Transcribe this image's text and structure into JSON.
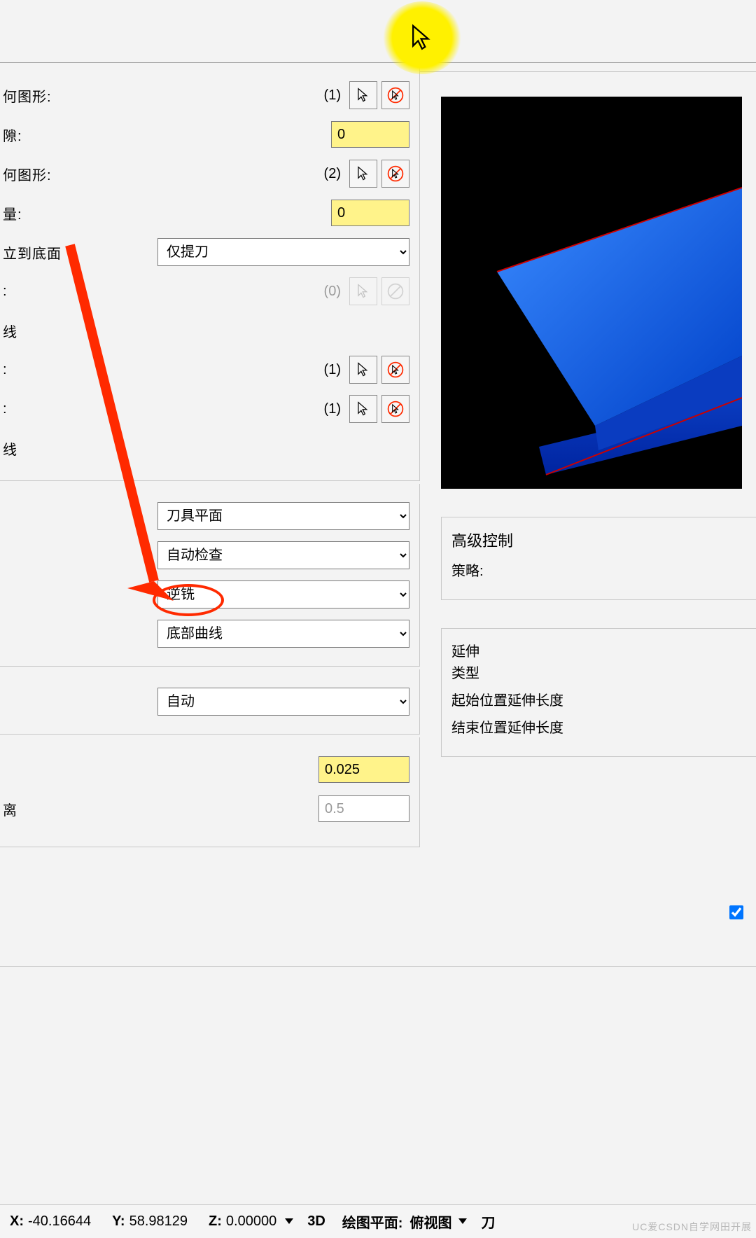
{
  "rows": {
    "r1": {
      "label": "何图形:",
      "count": "(1)"
    },
    "r2": {
      "label": "隙:",
      "value": "0"
    },
    "r3": {
      "label": "何图形:",
      "count": "(2)"
    },
    "r4": {
      "label": "量:",
      "value": "0"
    },
    "r5": {
      "label": "立到底面"
    },
    "r6": {
      "label": ":",
      "count": "(0)"
    },
    "r7": {
      "label": "线"
    },
    "r8": {
      "label": ":",
      "count": "(1)"
    },
    "r9": {
      "label": ":",
      "count": "(1)"
    },
    "r10": {
      "label": "线"
    },
    "r11": {
      "label": "离"
    }
  },
  "combos": {
    "c1": "仅提刀",
    "c2": "刀具平面",
    "c3": "自动检查",
    "c4": "逆铣",
    "c5": "底部曲线",
    "c6": "自动"
  },
  "inputs": {
    "val1": "0.025",
    "val2": "0.5"
  },
  "right": {
    "adv_title": "高级控制",
    "strategy": "策略:",
    "ext_title": "延伸",
    "ext_type": "类型",
    "ext_start": "起始位置延伸长度",
    "ext_end": "结束位置延伸长度"
  },
  "checkbox": {
    "label": ""
  },
  "status": {
    "x_label": "X:",
    "x": "-40.16644",
    "y_label": "Y:",
    "y": "58.98129",
    "z_label": "Z:",
    "z": "0.00000",
    "mode": "3D",
    "plane_label": "绘图平面:",
    "plane": "俯视图",
    "tail": "刀"
  },
  "watermark": "UC爱CSDN自学网田开展"
}
